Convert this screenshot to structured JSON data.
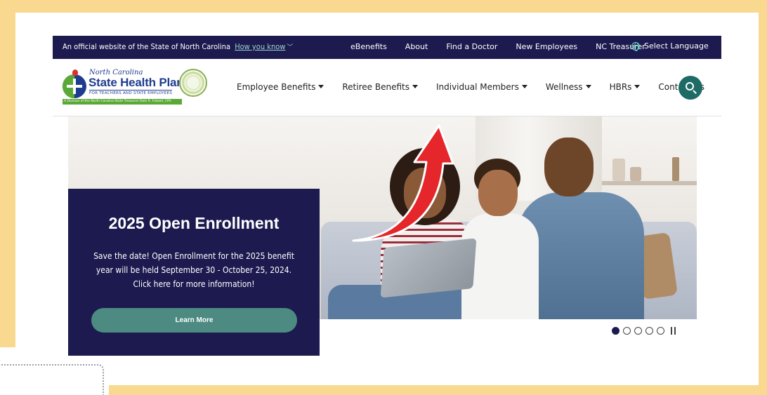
{
  "topbar": {
    "official_text": "An official website of the State of North Carolina",
    "how_you_know": "How you know",
    "links": [
      "eBenefits",
      "About",
      "Find a Doctor",
      "New Employees",
      "NC Treasurer"
    ],
    "language": "Select Language"
  },
  "logo": {
    "line1": "North Carolina",
    "line2": "State Health Plan",
    "line3": "FOR TEACHERS AND STATE EMPLOYEES",
    "division": "A Division of the North Carolina State Treasurer Dale R. Folwell, CPA"
  },
  "nav": {
    "employee_benefits": "Employee Benefits",
    "retiree_benefits": "Retiree Benefits",
    "individual_members": "Individual Members",
    "wellness": "Wellness",
    "hbrs": "HBRs",
    "contact_us": "Contact Us"
  },
  "promo": {
    "title": "2025 Open Enrollment",
    "description": "Save the date! Open Enrollment for the 2025 benefit year will be held September 30 - October 25, 2024. Click here for more information!",
    "button": "Learn More"
  },
  "carousel": {
    "slides": 5,
    "active": 1
  },
  "colors": {
    "navy": "#1c1a4f",
    "teal": "#1e6b66",
    "button_teal": "#4c8a82",
    "frame_yellow": "#f9d98f",
    "annotation_red": "#e5262b"
  }
}
